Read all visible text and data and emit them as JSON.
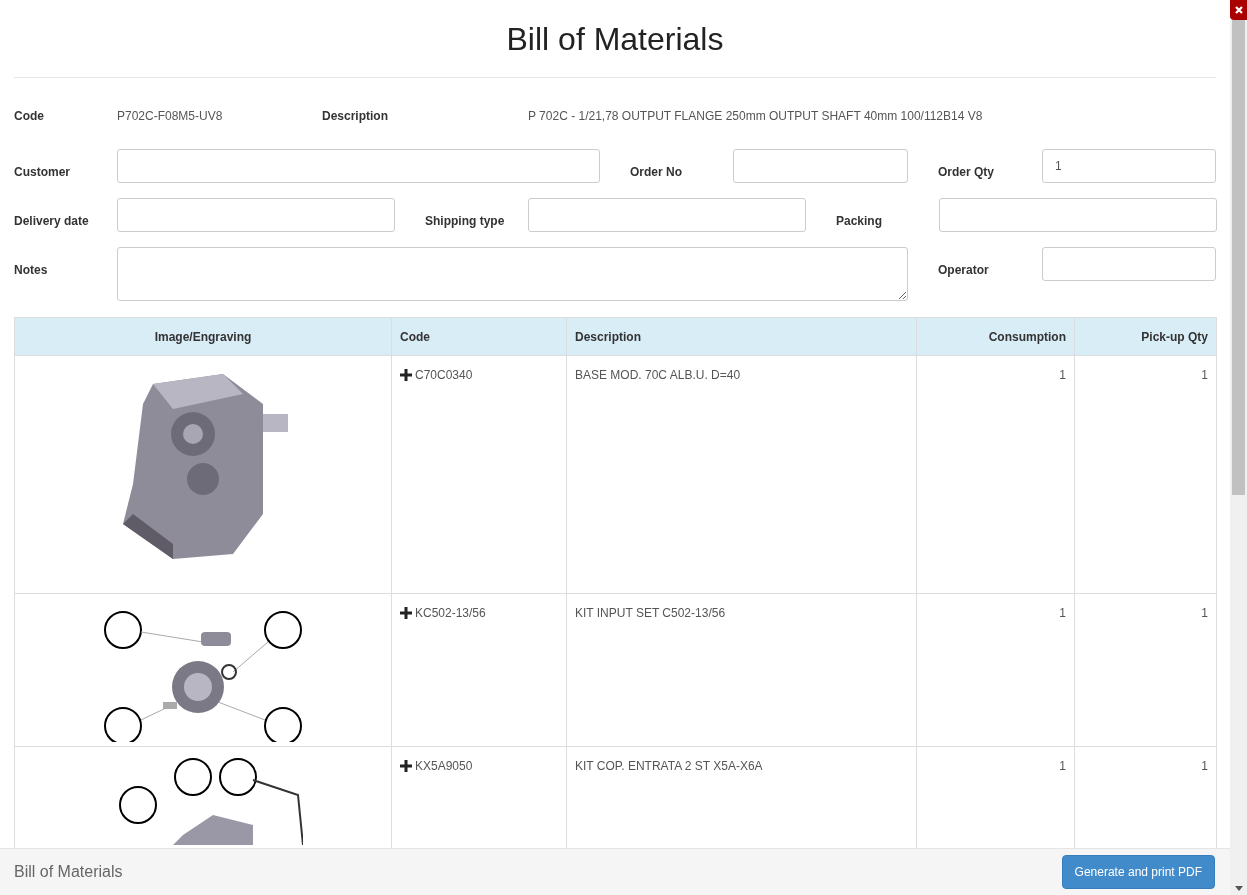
{
  "dialog": {
    "title": "Bill of Materials"
  },
  "summary": [
    {
      "label": "Code",
      "value": "P702C-F08M5-UV8"
    },
    {
      "label": "Description",
      "value": "P 702C - 1/21,78 OUTPUT FLANGE 250mm OUTPUT SHAFT 40mm 100/112B14 V8"
    }
  ],
  "form_rows": [
    [
      {
        "label": "Customer",
        "kind": "input"
      },
      {
        "label": "Order No",
        "kind": "input"
      },
      {
        "label": "Order Qty",
        "kind": "input",
        "value": "1"
      }
    ],
    [
      {
        "label": "Delivery date",
        "kind": "input"
      },
      {
        "label": "Shipping type",
        "kind": "input"
      },
      {
        "label": "Packing",
        "kind": "input"
      }
    ],
    [
      {
        "label": "Notes",
        "kind": "textarea"
      },
      {
        "label": "Operator",
        "kind": "input"
      }
    ]
  ],
  "table": {
    "columns": [
      "Image/Engraving",
      "Code",
      "Description",
      "Consumption",
      "Pick-up Qty"
    ],
    "rows": [
      {
        "kind": "housing",
        "code": "C70C0340",
        "description": "BASE MOD. 70C ALB.U. D=40",
        "consumption": "1",
        "pickup_qty": "1"
      },
      {
        "kind": "gearkit",
        "code": "KC502-13/56",
        "description": "KIT INPUT SET C502-13/56",
        "consumption": "1",
        "pickup_qty": "1"
      },
      {
        "kind": "cover",
        "code": "KX5A9050",
        "description": "KIT COP. ENTRATA 2 ST X5A-X6A",
        "consumption": "1",
        "pickup_qty": "1"
      }
    ]
  },
  "footer": {
    "title": "Bill of Materials",
    "button": "Generate and print PDF"
  }
}
